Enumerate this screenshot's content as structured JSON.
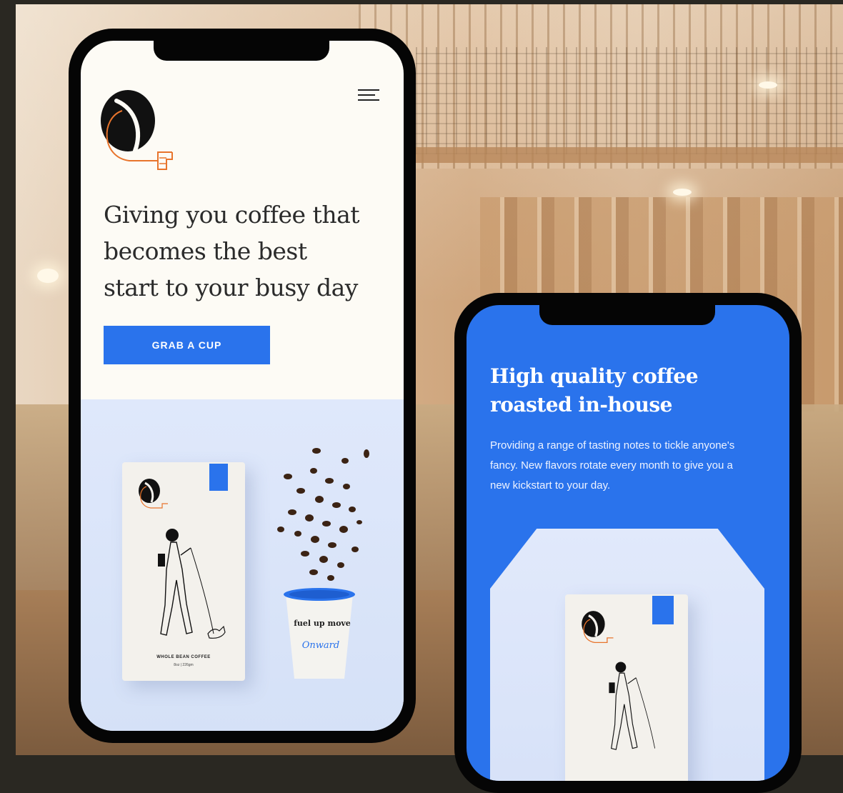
{
  "phone_left": {
    "menu_icon": "hamburger-menu-icon",
    "logo_icon": "coffee-bean-hand-logo",
    "hero_heading": "Giving you coffee that becomes the best start to your busy day",
    "cta_label": "GRAB A CUP",
    "bag_label": "WHOLE BEAN COFFEE",
    "bag_weight": "8oz | 226gm",
    "cup_text": "fuel up move",
    "cup_script": "Onward"
  },
  "phone_right": {
    "heading": "High quality coffee roasted in-house",
    "body": "Providing a range of tasting notes to tickle anyone's fancy. New flavors rotate every month to give you a new kickstart to your day."
  },
  "colors": {
    "accent": "#2a73ec",
    "cream": "#fdfbf5",
    "logo_orange": "#e8742c"
  }
}
